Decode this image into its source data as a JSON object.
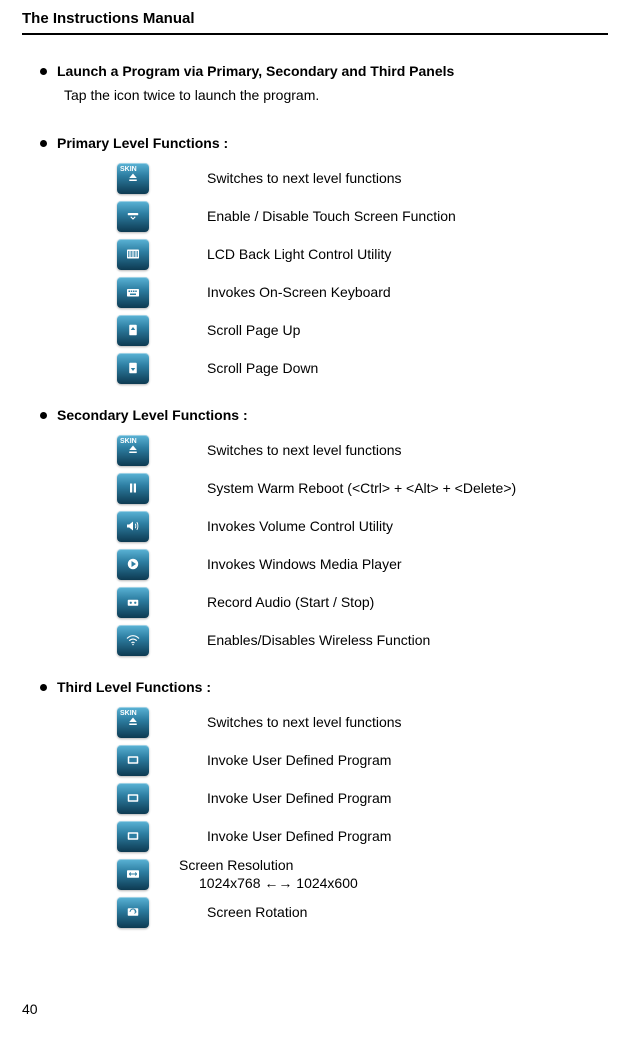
{
  "header": {
    "title": "The Instructions Manual"
  },
  "section_launch": {
    "heading": "Launch a Program via Primary, Secondary and Third Panels",
    "intro": "Tap the icon twice to launch the program."
  },
  "primary": {
    "heading": "Primary Level Functions :",
    "items": [
      {
        "icon": "skin-icon",
        "desc": "Switches to next level functions"
      },
      {
        "icon": "touch-icon",
        "desc": "Enable / Disable Touch Screen Function"
      },
      {
        "icon": "backlight-icon",
        "desc": "LCD Back Light Control Utility"
      },
      {
        "icon": "keyboard-icon",
        "desc": "Invokes On-Screen Keyboard"
      },
      {
        "icon": "scroll-up-icon",
        "desc": "Scroll Page Up"
      },
      {
        "icon": "scroll-down-icon",
        "desc": "Scroll Page Down"
      }
    ]
  },
  "secondary": {
    "heading": "Secondary Level Functions :",
    "items": [
      {
        "icon": "skin-icon",
        "desc": "Switches to next level functions"
      },
      {
        "icon": "reboot-icon",
        "desc": "System Warm Reboot (<Ctrl> + <Alt> + <Delete>)"
      },
      {
        "icon": "volume-icon",
        "desc": "Invokes Volume Control Utility"
      },
      {
        "icon": "media-player-icon",
        "desc": "Invokes Windows Media Player"
      },
      {
        "icon": "record-icon",
        "desc": "Record Audio (Start / Stop)"
      },
      {
        "icon": "wireless-icon",
        "desc": "Enables/Disables Wireless Function"
      }
    ]
  },
  "third": {
    "heading": "Third Level Functions :",
    "items": [
      {
        "icon": "skin-icon",
        "desc": "Switches to next level functions"
      },
      {
        "icon": "user-prog-icon",
        "desc": "Invoke User Defined Program"
      },
      {
        "icon": "user-prog-icon",
        "desc": "Invoke User Defined Program"
      },
      {
        "icon": "user-prog-icon",
        "desc": "Invoke User Defined Program"
      },
      {
        "icon": "resolution-icon",
        "desc_line1": "Screen Resolution",
        "desc_line2": "1024x768 ←→ 1024x600"
      },
      {
        "icon": "rotation-icon",
        "desc": "Screen Rotation"
      }
    ]
  },
  "page_number": "40"
}
